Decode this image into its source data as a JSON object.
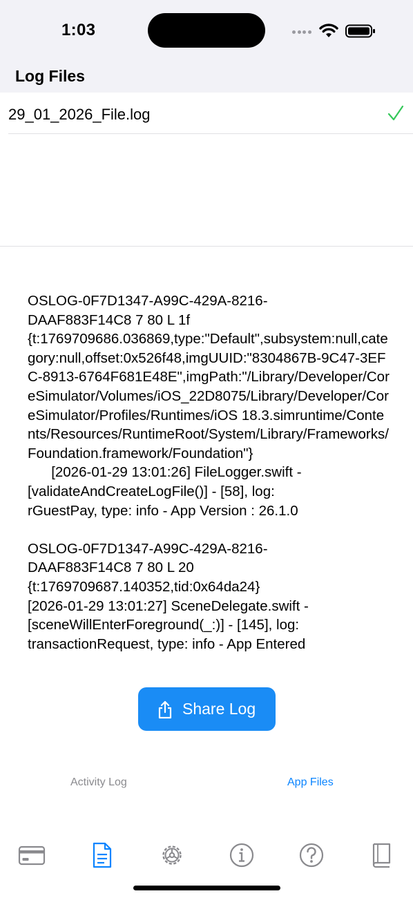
{
  "status_bar": {
    "time": "1:03"
  },
  "header": {
    "title": "Log Files"
  },
  "files": [
    {
      "name": "29_01_2026_File.log",
      "selected": true
    }
  ],
  "log": {
    "content": "OSLOG-0F7D1347-A99C-429A-8216-\nDAAF883F14C8 7 80 L 1f\n{t:1769709686.036869,type:\"Default\",subsystem:null,category:null,offset:0x526f48,imgUUID:\"8304867B-9C47-3EFC-8913-6764F681E48E\",imgPath:\"/Library/Developer/CoreSimulator/Volumes/iOS_22D8075/Library/Developer/CoreSimulator/Profiles/Runtimes/iOS 18.3.simruntime/Contents/Resources/RuntimeRoot/System/Library/Frameworks/Foundation.framework/Foundation\"}\n      [2026-01-29 13:01:26] FileLogger.swift -\n[validateAndCreateLogFile()] - [58], log:\nrGuestPay, type: info - App Version : 26.1.0\n\nOSLOG-0F7D1347-A99C-429A-8216-\nDAAF883F14C8 7 80 L 20\n{t:1769709687.140352,tid:0x64da24}\n[2026-01-29 13:01:27] SceneDelegate.swift -\n[sceneWillEnterForeground(_:)] - [145], log:\ntransactionRequest, type: info - App Entered"
  },
  "actions": {
    "share_label": "Share Log"
  },
  "segments": {
    "activity_label": "Activity Log",
    "app_files_label": "App Files",
    "active": "App Files"
  },
  "colors": {
    "accent": "#1a8cf5",
    "check": "#34c759",
    "inactive": "#8a8a8e"
  },
  "tab_bar": {
    "items": [
      {
        "icon": "card-icon",
        "active": false
      },
      {
        "icon": "document-icon",
        "active": true
      },
      {
        "icon": "gear-icon",
        "active": false
      },
      {
        "icon": "info-icon",
        "active": false
      },
      {
        "icon": "help-icon",
        "active": false
      },
      {
        "icon": "book-icon",
        "active": false
      }
    ]
  }
}
